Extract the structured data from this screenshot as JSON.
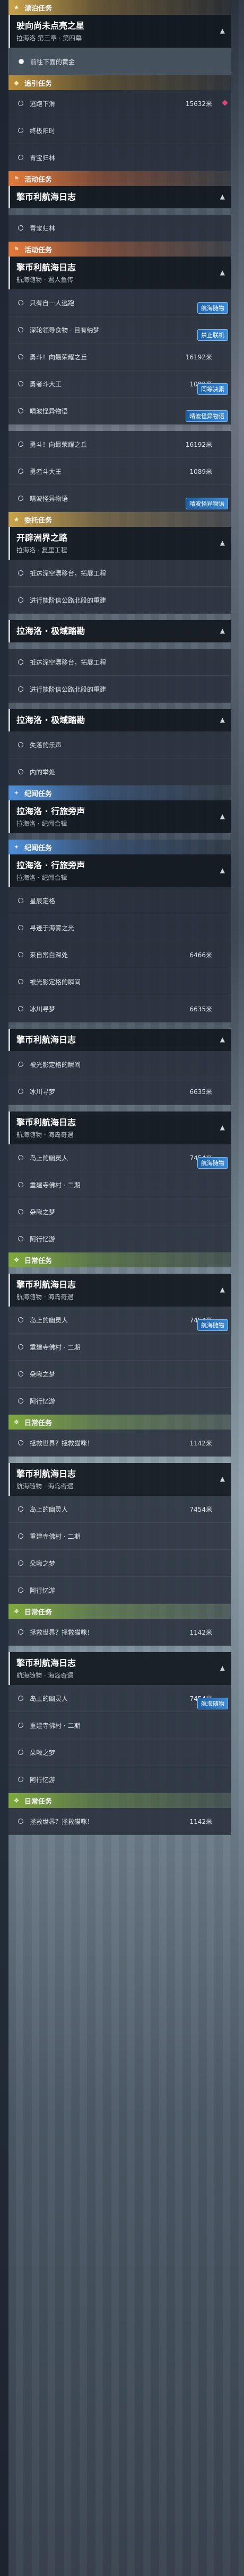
{
  "sections": [
    {
      "kind": "cat",
      "style": "c-main",
      "icon": "star-icon",
      "glyph": "★",
      "label": "漂泊任务"
    },
    {
      "kind": "head",
      "title": "驶向尚未点亮之星",
      "sub": "拉海洛 第三章 · 第四幕"
    },
    {
      "kind": "row",
      "label": "前往下面的黄金",
      "selected": true
    },
    {
      "kind": "cat",
      "style": "c-side",
      "icon": "compass-icon",
      "glyph": "◆",
      "label": "追引任务"
    },
    {
      "kind": "row",
      "label": "逃跑下滑",
      "dist": "15632米",
      "mark": true
    },
    {
      "kind": "row",
      "label": "终极阳时"
    },
    {
      "kind": "row",
      "label": "青宝归林"
    },
    {
      "kind": "cat",
      "style": "c-act",
      "icon": "flag-icon",
      "glyph": "⚑",
      "label": "活动任务"
    },
    {
      "kind": "head",
      "title": "擎币利航海日志",
      "sub": ""
    },
    {
      "kind": "gap"
    },
    {
      "kind": "row",
      "label": "青宝归林"
    },
    {
      "kind": "cat",
      "style": "c-act",
      "icon": "flag-icon",
      "glyph": "⚑",
      "label": "活动任务"
    },
    {
      "kind": "head",
      "title": "擎币利航海日志",
      "sub": "航海随物 · 君人鱼传"
    },
    {
      "kind": "row",
      "label": "只有自一人逃跑",
      "badge": "航海随物"
    },
    {
      "kind": "row",
      "label": "深轮领导食物 · 目有纳梦",
      "badge": "禁止联机"
    },
    {
      "kind": "row",
      "label": "勇斗！向最荣耀之丘",
      "dist": "16192米"
    },
    {
      "kind": "row",
      "label": "勇者斗大王",
      "dist": "1089米",
      "badge": "同等决素"
    },
    {
      "kind": "row",
      "label": "晴波怪异物语",
      "badge": "晴波怪异物语"
    },
    {
      "kind": "gap"
    },
    {
      "kind": "row",
      "label": "勇斗！向最荣耀之丘",
      "dist": "16192米"
    },
    {
      "kind": "row",
      "label": "勇者斗大王",
      "dist": "1089米"
    },
    {
      "kind": "row",
      "label": "晴波怪异物语",
      "badge": "晴波怪异物语"
    },
    {
      "kind": "cat",
      "style": "c-main",
      "icon": "star-icon",
      "glyph": "★",
      "label": "委托任务"
    },
    {
      "kind": "head",
      "title": "开辟洲界之路",
      "sub": "拉海洛 · 复里工程"
    },
    {
      "kind": "row",
      "label": "抵达深空漂移台，拓展工程"
    },
    {
      "kind": "row",
      "label": "进行能阶信公路北段的重建"
    },
    {
      "kind": "gap"
    },
    {
      "kind": "head",
      "title": "拉海洛 · 极域踏勘",
      "sub": ""
    },
    {
      "kind": "gap"
    },
    {
      "kind": "row",
      "label": "抵达深空漂移台，拓展工程"
    },
    {
      "kind": "row",
      "label": "进行能阶信公路北段的重建"
    },
    {
      "kind": "gap"
    },
    {
      "kind": "head",
      "title": "拉海洛 · 极域踏勘",
      "sub": ""
    },
    {
      "kind": "row",
      "label": "失落的乐声"
    },
    {
      "kind": "row",
      "label": "内的举处"
    },
    {
      "kind": "cat",
      "style": "c-mem",
      "icon": "book-icon",
      "glyph": "✦",
      "label": "纪闻任务"
    },
    {
      "kind": "head",
      "title": "拉海洛 · 行旅旁声",
      "sub": "拉海洛 · 纪闻合辑"
    },
    {
      "kind": "gap"
    },
    {
      "kind": "cat",
      "style": "c-mem",
      "icon": "book-icon",
      "glyph": "✦",
      "label": "纪闻任务"
    },
    {
      "kind": "head",
      "title": "拉海洛 · 行旅旁声",
      "sub": "拉海洛 · 纪闻合辑"
    },
    {
      "kind": "row",
      "label": "星辰定格"
    },
    {
      "kind": "row",
      "label": "寻迹于海雾之光"
    },
    {
      "kind": "row",
      "label": "来自常白深处",
      "dist": "6466米"
    },
    {
      "kind": "row",
      "label": "被光影定格的瞬间"
    },
    {
      "kind": "row",
      "label": "冰川寻梦",
      "dist": "6635米"
    },
    {
      "kind": "gap"
    },
    {
      "kind": "head",
      "title": "擎币利航海日志",
      "sub": ""
    },
    {
      "kind": "row",
      "label": "被光影定格的瞬间"
    },
    {
      "kind": "row",
      "label": "冰川寻梦",
      "dist": "6635米"
    },
    {
      "kind": "gap"
    },
    {
      "kind": "head",
      "title": "擎币利航海日志",
      "sub": "航海随物 · 海岛奇遇"
    },
    {
      "kind": "row",
      "label": "岛上的幽灵人",
      "dist": "7454米",
      "badge": "航海随物"
    },
    {
      "kind": "row",
      "label": "重建寺佛村 · 二期"
    },
    {
      "kind": "row",
      "label": "朵啾之梦"
    },
    {
      "kind": "row",
      "label": "阿行忆游"
    },
    {
      "kind": "cat",
      "style": "c-day",
      "icon": "leaf-icon",
      "glyph": "❖",
      "label": "日常任务"
    },
    {
      "kind": "gap"
    },
    {
      "kind": "head",
      "title": "擎币利航海日志",
      "sub": "航海随物 · 海岛奇遇"
    },
    {
      "kind": "row",
      "label": "岛上的幽灵人",
      "dist": "7454米",
      "badge": "航海随物"
    },
    {
      "kind": "row",
      "label": "重建寺佛村 · 二期"
    },
    {
      "kind": "row",
      "label": "朵啾之梦"
    },
    {
      "kind": "row",
      "label": "阿行忆游"
    },
    {
      "kind": "cat",
      "style": "c-day",
      "icon": "leaf-icon",
      "glyph": "❖",
      "label": "日常任务"
    },
    {
      "kind": "row",
      "label": "拯救世界？拯救猫咪！",
      "dist": "1142米"
    },
    {
      "kind": "gap"
    },
    {
      "kind": "head",
      "title": "擎币利航海日志",
      "sub": "航海随物 · 海岛奇遇"
    },
    {
      "kind": "row",
      "label": "岛上的幽灵人",
      "dist": "7454米"
    },
    {
      "kind": "row",
      "label": "重建寺佛村 · 二期"
    },
    {
      "kind": "row",
      "label": "朵啾之梦"
    },
    {
      "kind": "row",
      "label": "阿行忆游"
    },
    {
      "kind": "cat",
      "style": "c-day",
      "icon": "leaf-icon",
      "glyph": "❖",
      "label": "日常任务"
    },
    {
      "kind": "row",
      "label": "拯救世界？拯救猫咪！",
      "dist": "1142米"
    },
    {
      "kind": "gap"
    },
    {
      "kind": "head",
      "title": "擎币利航海日志",
      "sub": "航海随物 · 海岛奇遇"
    },
    {
      "kind": "row",
      "label": "岛上的幽灵人",
      "dist": "7454米",
      "badge": "航海随物"
    },
    {
      "kind": "row",
      "label": "重建寺佛村 · 二期"
    },
    {
      "kind": "row",
      "label": "朵啾之梦"
    },
    {
      "kind": "row",
      "label": "阿行忆游"
    },
    {
      "kind": "cat",
      "style": "c-day",
      "icon": "leaf-icon",
      "glyph": "❖",
      "label": "日常任务"
    },
    {
      "kind": "row",
      "label": "拯救世界？拯救猫咪！",
      "dist": "1142米"
    }
  ]
}
